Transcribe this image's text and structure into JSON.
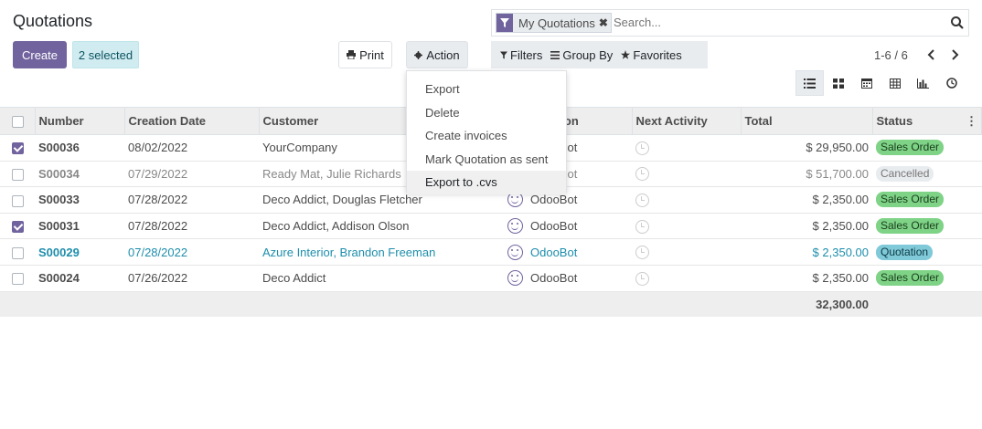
{
  "page": {
    "title": "Quotations"
  },
  "toolbar": {
    "create_label": "Create",
    "selected_label": "2 selected",
    "print_label": "Print",
    "action_label": "Action"
  },
  "search": {
    "facet_label": "My Quotations",
    "placeholder": "Search..."
  },
  "filters": {
    "filters_label": "Filters",
    "groupby_label": "Group By",
    "favorites_label": "Favorites"
  },
  "pager": {
    "text": "1-6 / 6"
  },
  "views": [
    "list-view",
    "kanban-view",
    "calendar-view",
    "pivot-view",
    "graph-view",
    "activity-view"
  ],
  "action_menu": {
    "items": [
      "Export",
      "Delete",
      "Create invoices",
      "Mark Quotation as sent",
      "Export to .cvs"
    ],
    "highlighted": "Export to .cvs"
  },
  "table": {
    "columns": [
      "Number",
      "Creation Date",
      "Customer",
      "Salesperson",
      "Next Activity",
      "Total",
      "Status"
    ],
    "rows": [
      {
        "selected": true,
        "number": "S00036",
        "date": "08/02/2022",
        "customer": "YourCompany",
        "salesperson": "OdooBot",
        "total": "$ 29,950.00",
        "status": "Sales Order"
      },
      {
        "selected": false,
        "number": "S00034",
        "date": "07/29/2022",
        "customer": "Ready Mat, Julie Richards",
        "salesperson": "OdooBot",
        "total": "$ 51,700.00",
        "status": "Cancelled"
      },
      {
        "selected": false,
        "number": "S00033",
        "date": "07/28/2022",
        "customer": "Deco Addict, Douglas Fletcher",
        "salesperson": "OdooBot",
        "total": "$ 2,350.00",
        "status": "Sales Order"
      },
      {
        "selected": true,
        "number": "S00031",
        "date": "07/28/2022",
        "customer": "Deco Addict, Addison Olson",
        "salesperson": "OdooBot",
        "total": "$ 2,350.00",
        "status": "Sales Order"
      },
      {
        "selected": false,
        "number": "S00029",
        "date": "07/28/2022",
        "customer": "Azure Interior, Brandon Freeman",
        "salesperson": "OdooBot",
        "total": "$ 2,350.00",
        "status": "Quotation"
      },
      {
        "selected": false,
        "number": "S00024",
        "date": "07/26/2022",
        "customer": "Deco Addict",
        "salesperson": "OdooBot",
        "total": "$ 2,350.00",
        "status": "Sales Order"
      }
    ],
    "grand_total": "32,300.00"
  },
  "colors": {
    "primary": "#71639e",
    "sales_order": "#7ed386",
    "quotation": "#7fc9d8",
    "link": "#1e8eac"
  }
}
